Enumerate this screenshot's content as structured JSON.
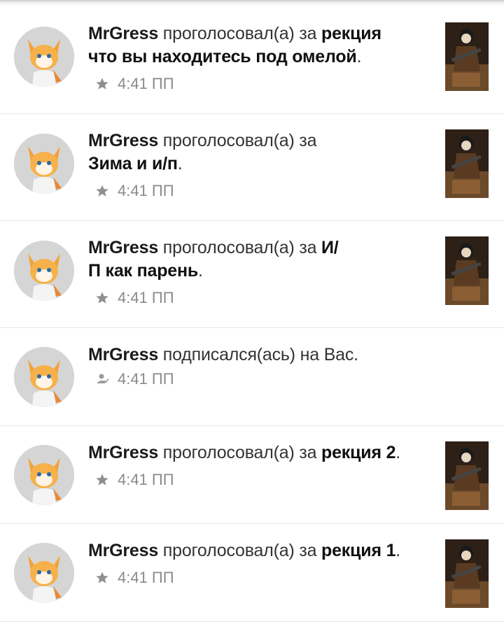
{
  "notifications": [
    {
      "user": "MrGress",
      "action": "проголосовал(а) за",
      "target": "рекция что вы находитесь под омелой",
      "target_line1": "рекция",
      "target_line2": "что вы находитесь под омелой",
      "end": ".",
      "time": "4:41 ПП",
      "icon": "star-icon",
      "type": "vote"
    },
    {
      "user": "MrGress",
      "action": "проголосовал(а) за",
      "target": "Зима и и/п",
      "end": ".",
      "time": "4:41 ПП",
      "icon": "star-icon",
      "type": "vote"
    },
    {
      "user": "MrGress",
      "action": "проголосовал(а) за",
      "target": "И/П как парень",
      "target_line1": "И/",
      "target_line2": "П как парень",
      "end": ".",
      "time": "4:41 ПП",
      "icon": "star-icon",
      "type": "vote"
    },
    {
      "user": "MrGress",
      "action": "подписался(ась) на Вас.",
      "time": "4:41 ПП",
      "icon": "follow-icon",
      "type": "follow"
    },
    {
      "user": "MrGress",
      "action": "проголосовал(а) за",
      "target": "рекция 2",
      "end": ".",
      "time": "4:41 ПП",
      "icon": "star-icon",
      "type": "vote"
    },
    {
      "user": "MrGress",
      "action": "проголосовал(а) за",
      "target": "рекция 1",
      "end": ".",
      "time": "4:41 ПП",
      "icon": "star-icon",
      "type": "vote"
    }
  ],
  "colors": {
    "text": "#222222",
    "meta": "#8a8a8a",
    "divider": "#e8e8e8",
    "avatar_bg": "#d7d7d7",
    "thumb_bg": "#3a2a1e"
  }
}
